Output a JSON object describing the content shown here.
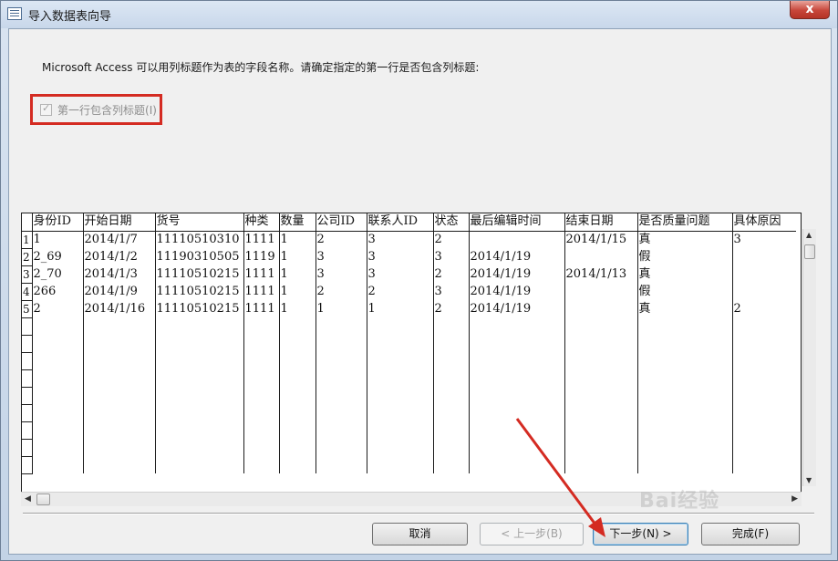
{
  "window": {
    "title": "导入数据表向导",
    "close_glyph": "x"
  },
  "description": "Microsoft Access 可以用列标题作为表的字段名称。请确定指定的第一行是否包含列标题:",
  "checkbox": {
    "label": "第一行包含列标题",
    "hotkey": "(I)",
    "checked": true,
    "disabled": true
  },
  "grid": {
    "columns": [
      "身份ID",
      "开始日期",
      "货号",
      "种类",
      "数量",
      "公司ID",
      "联系人ID",
      "状态",
      "最后编辑时间",
      "结束日期",
      "是否质量问题",
      "具体原因"
    ],
    "rows": [
      [
        "1",
        "2014/1/7",
        "11110510310",
        "1111",
        "1",
        "2",
        "3",
        "2",
        "",
        "2014/1/15",
        "真",
        "3"
      ],
      [
        "2_69",
        "2014/1/2",
        "11190310505",
        "1119",
        "1",
        "3",
        "3",
        "3",
        "2014/1/19",
        "",
        "假",
        ""
      ],
      [
        "2_70",
        "2014/1/3",
        "11110510215",
        "1111",
        "1",
        "3",
        "3",
        "2",
        "2014/1/19",
        "2014/1/13",
        "真",
        ""
      ],
      [
        "266",
        "2014/1/9",
        "11110510215",
        "1111",
        "1",
        "2",
        "2",
        "3",
        "2014/1/19",
        "",
        "假",
        ""
      ],
      [
        "2",
        "2014/1/16",
        "11110510215",
        "1111",
        "1",
        "1",
        "1",
        "2",
        "2014/1/19",
        "",
        "真",
        "2"
      ]
    ],
    "row_numbers": [
      "1",
      "2",
      "3",
      "4",
      "5"
    ]
  },
  "buttons": {
    "cancel": "取消",
    "back": "< 上一步(B)",
    "next": "下一步(N) >",
    "finish": "完成(F)"
  },
  "colors": {
    "highlight_red": "#d42b22",
    "window_frame": "#c9d6e6"
  },
  "watermark": "Bai经验"
}
